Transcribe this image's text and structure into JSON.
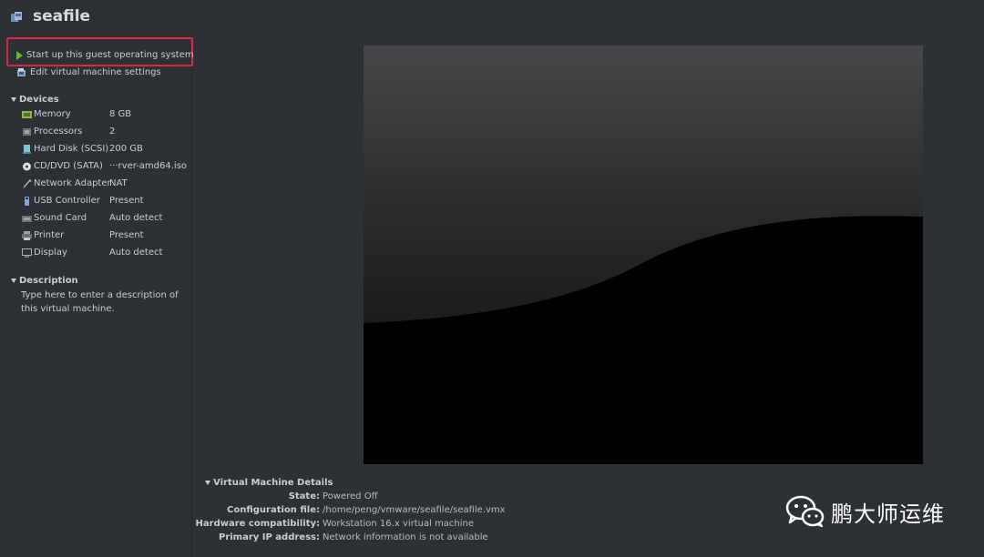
{
  "window": {
    "title": "seafile",
    "icon": "vm-icon"
  },
  "actions": {
    "start_label": "Start up this guest operating system",
    "edit_label": "Edit virtual machine settings"
  },
  "devices": {
    "header": "Devices",
    "items": [
      {
        "name": "Memory",
        "value": "8 GB",
        "icon": "memory-icon"
      },
      {
        "name": "Processors",
        "value": "2",
        "icon": "processor-icon"
      },
      {
        "name": "Hard Disk (SCSI)",
        "value": "200 GB",
        "icon": "hard-disk-icon"
      },
      {
        "name": "CD/DVD (SATA)",
        "value": "···rver-amd64.iso",
        "icon": "cd-dvd-icon"
      },
      {
        "name": "Network Adapter",
        "value": "NAT",
        "icon": "network-adapter-icon"
      },
      {
        "name": "USB Controller",
        "value": "Present",
        "icon": "usb-controller-icon"
      },
      {
        "name": "Sound Card",
        "value": "Auto detect",
        "icon": "sound-card-icon"
      },
      {
        "name": "Printer",
        "value": "Present",
        "icon": "printer-icon"
      },
      {
        "name": "Display",
        "value": "Auto detect",
        "icon": "display-icon"
      }
    ]
  },
  "description": {
    "header": "Description",
    "placeholder": "Type here to enter a description of this virtual machine."
  },
  "details": {
    "header": "Virtual Machine Details",
    "rows": [
      {
        "label": "State:",
        "value": "Powered Off"
      },
      {
        "label": "Configuration file:",
        "value": "/home/peng/vmware/seafile/seafile.vmx"
      },
      {
        "label": "Hardware compatibility:",
        "value": "Workstation 16.x virtual machine"
      },
      {
        "label": "Primary IP address:",
        "value": "Network information is not available"
      }
    ]
  },
  "watermark": {
    "text": "鹏大师运维",
    "icon": "wechat-icon"
  },
  "colors": {
    "background": "#2d3035",
    "highlight": "#d9294a",
    "play": "#5bbf2d"
  }
}
